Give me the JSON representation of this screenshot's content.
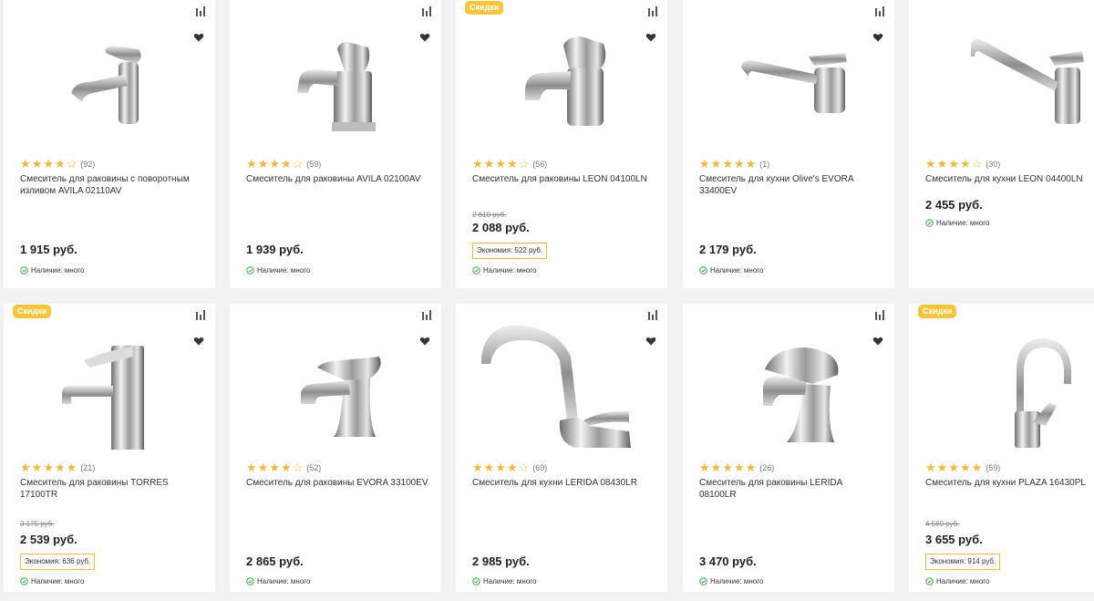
{
  "cards": [
    {
      "rating_count": "(92)",
      "stars": 4,
      "title": "Смеситель для раковины с поворотным изливом AVILA 02110AV",
      "price": "1 915 руб.",
      "stock": "Наличие: много"
    },
    {
      "rating_count": "(59)",
      "stars": 4,
      "title": "Смеситель для раковины AVILA 02100AV",
      "price": "1 939 руб.",
      "stock": "Наличие: много"
    },
    {
      "badge": "Скидки",
      "rating_count": "(56)",
      "stars": 4,
      "title": "Смеситель для раковины LEON 04100LN",
      "old_price": "2 610 руб.",
      "price": "2 088 руб.",
      "savings": "Экономия: 522 руб.",
      "stock": "Наличие: много"
    },
    {
      "rating_count": "(1)",
      "stars": 5,
      "title": "Смеситель для кухни Olive's EVORA 33400EV",
      "price": "2 179 руб.",
      "stock": "Наличие: много"
    },
    {
      "rating_count": "(30)",
      "stars": 4,
      "title": "Смеситель для кухни LEON 04400LN",
      "price": "2 455 руб.",
      "stock": "Наличие: много"
    },
    {
      "badge": "Скидки",
      "rating_count": "(21)",
      "stars": 5,
      "title": "Смеситель для раковины TORRES 17100TR",
      "old_price": "3 175 руб.",
      "price": "2 539 руб.",
      "savings": "Экономия: 636 руб.",
      "stock": "Наличие: много"
    },
    {
      "rating_count": "(52)",
      "stars": 4,
      "title": "Смеситель для раковины EVORA 33100EV",
      "price": "2 865 руб.",
      "stock": "Наличие: много"
    },
    {
      "rating_count": "(69)",
      "stars": 4,
      "title": "Смеситель для кухни LERIDA 08430LR",
      "price": "2 985 руб.",
      "stock": "Наличие: много"
    },
    {
      "rating_count": "(26)",
      "stars": 5,
      "title": "Смеситель для раковины LERIDA 08100LR",
      "price": "3 470 руб.",
      "stock": "Наличие: много"
    },
    {
      "badge": "Скидки",
      "rating_count": "(59)",
      "stars": 5,
      "title": "Смеситель для кухни PLAZA 16430PL",
      "old_price": "4 569 руб.",
      "price": "3 655 руб.",
      "savings": "Экономия: 914 руб.",
      "stock": "Наличие: много"
    }
  ],
  "colors": {
    "accent": "#f6c53d",
    "star": "#f0b83e",
    "stock_icon": "#4caf50"
  },
  "icons": {
    "compare": "bar-chart-icon",
    "favorite": "heart-icon",
    "stock": "check-circle-icon"
  }
}
